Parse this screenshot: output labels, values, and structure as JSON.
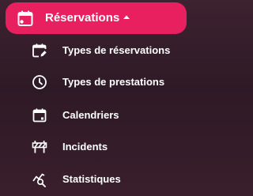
{
  "colors": {
    "accent": "#e8205f",
    "text": "#ffffff",
    "background": "#33202b"
  },
  "header": {
    "label": "Réservations",
    "icon": "calendar-event-icon",
    "state": "expanded"
  },
  "items": [
    {
      "label": "Types de réservations",
      "icon": "calendar-edit-icon"
    },
    {
      "label": "Types de prestations",
      "icon": "clock-icon"
    },
    {
      "label": "Calendriers",
      "icon": "calendar-icon"
    },
    {
      "label": "Incidents",
      "icon": "barrier-icon"
    },
    {
      "label": "Statistiques",
      "icon": "chart-search-icon"
    }
  ]
}
